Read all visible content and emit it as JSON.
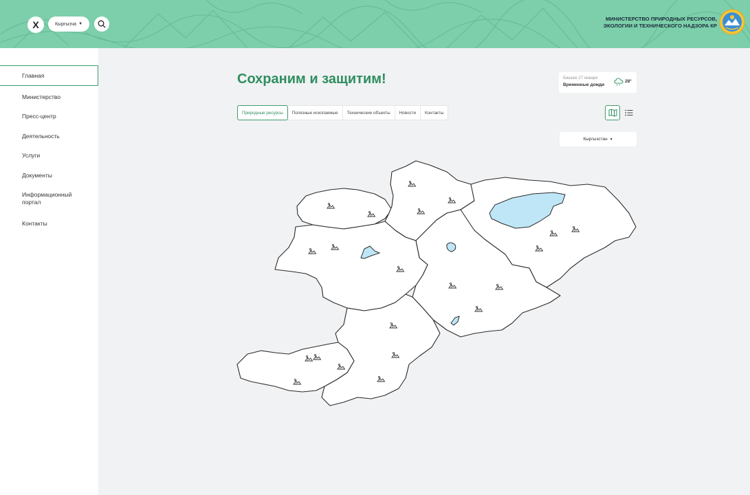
{
  "header": {
    "close_label": "X",
    "language": "Кыргызча",
    "ministry_line1": "МИНИСТЕРСТВО ПРИРОДНЫХ РЕСУРСОВ,",
    "ministry_line2": "ЭКОЛОГИИ И ТЕХНИЧЕСКОГО НАДЗОРА КР",
    "icons": {
      "search": "search-icon",
      "emblem": "state-emblem-icon",
      "caret": "caret-down-icon"
    }
  },
  "sidebar": {
    "items": [
      {
        "label": "Главная",
        "active": true
      },
      {
        "label": "Министерство",
        "active": false
      },
      {
        "label": "Пресс-центр",
        "active": false
      },
      {
        "label": "Деятельность",
        "active": false
      },
      {
        "label": "Услуги",
        "active": false
      },
      {
        "label": "Документы",
        "active": false
      },
      {
        "label": "Информационный портал",
        "active": false
      },
      {
        "label": "Контакты",
        "active": false
      }
    ]
  },
  "main": {
    "title": "Сохраним и защитим!",
    "weather": {
      "city_date": "Бишкек 27 января",
      "description": "Временные дожди",
      "temperature": "28°",
      "icon": "cloud-rain-icon"
    },
    "tabs": [
      {
        "label": "Природные ресурсы",
        "active": true
      },
      {
        "label": "Полезные ископаемые",
        "active": false
      },
      {
        "label": "Технические объекты",
        "active": false
      },
      {
        "label": "Новости",
        "active": false
      },
      {
        "label": "Контакты",
        "active": false
      }
    ],
    "view_toggle": {
      "map_icon": "map-icon",
      "list_icon": "list-icon",
      "active": "map"
    },
    "region_selector": {
      "value": "Кыргызстан"
    },
    "map": {
      "marker_icon": "mountain-marker-icon",
      "lake_color": "#bfe6f7",
      "region_fill": "#ffffff"
    }
  },
  "colors": {
    "header_bg": "#7ccfaa",
    "accent": "#2f8e5f",
    "page_bg": "#f1f2f4"
  }
}
